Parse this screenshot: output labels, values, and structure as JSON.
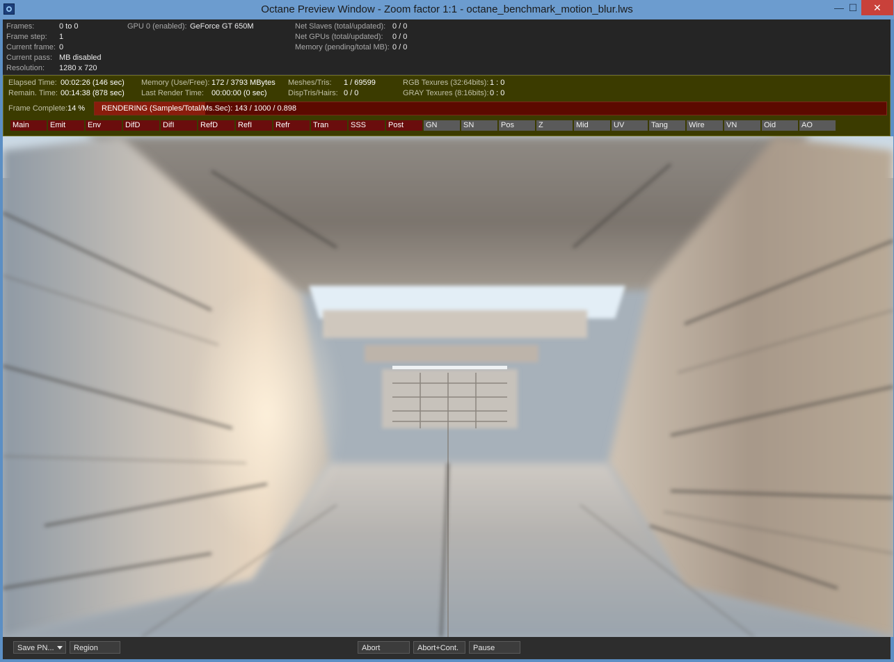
{
  "window": {
    "title": "Octane Preview Window - Zoom factor 1:1 - octane_benchmark_motion_blur.lws",
    "icons": [
      "app-icon",
      "minimize-icon",
      "maximize-icon",
      "close-icon"
    ],
    "minimize_glyph": "—",
    "maximize_glyph": "☐",
    "close_glyph": "✕"
  },
  "info": {
    "frames": {
      "label": "Frames:",
      "value": "0 to 0"
    },
    "frame_step": {
      "label": "Frame step:",
      "value": "1"
    },
    "current_frame": {
      "label": "Current frame:",
      "value": "0"
    },
    "current_pass": {
      "label": "Current pass:",
      "value": "MB disabled"
    },
    "resolution": {
      "label": "Resolution:",
      "value": "1280 x 720"
    },
    "gpu": {
      "label": "GPU  0 (enabled):",
      "value": "GeForce GT 650M"
    },
    "net_slaves": {
      "label": "Net Slaves (total/updated):",
      "value": "0 / 0"
    },
    "net_gpus": {
      "label": "Net GPUs (total/updated):",
      "value": "0 / 0"
    },
    "memory_pending": {
      "label": "Memory (pending/total MB):",
      "value": "0 / 0"
    }
  },
  "stats": {
    "elapsed": {
      "label": "Elapsed Time:",
      "value": "00:02:26 (146 sec)"
    },
    "remain": {
      "label": "Remain. Time:",
      "value": "00:14:38 (878 sec)"
    },
    "memory": {
      "label": "Memory (Use/Free):",
      "value": "172 / 3793 MBytes"
    },
    "last_render": {
      "label": "Last Render Time:",
      "value": "00:00:00 (0 sec)"
    },
    "meshes": {
      "label": "Meshes/Tris:",
      "value": "1 / 69599"
    },
    "disp": {
      "label": "DispTris/Hairs:",
      "value": "0 / 0"
    },
    "rgb_tex": {
      "label": "RGB Texures (32:64bits):",
      "value": "1 : 0"
    },
    "gray_tex": {
      "label": "GRAY Texures (8:16bits):",
      "value": "0 : 0"
    },
    "frame_complete": {
      "label": "Frame Complete:",
      "value": "14 %"
    },
    "progress_fraction": 0.14,
    "rendering_text": "RENDERING (Samples/Total/Ms.Sec): 143 / 1000 / 0.898"
  },
  "pass_tabs": [
    {
      "label": "Main",
      "active": true
    },
    {
      "label": "Emit",
      "active": true
    },
    {
      "label": "Env",
      "active": true
    },
    {
      "label": "DifD",
      "active": true
    },
    {
      "label": "DifI",
      "active": true
    },
    {
      "label": "RefD",
      "active": true
    },
    {
      "label": "RefI",
      "active": true
    },
    {
      "label": "Refr",
      "active": true
    },
    {
      "label": "Tran",
      "active": true
    },
    {
      "label": "SSS",
      "active": true
    },
    {
      "label": "Post",
      "active": true
    },
    {
      "label": "GN",
      "active": false
    },
    {
      "label": "SN",
      "active": false
    },
    {
      "label": "Pos",
      "active": false
    },
    {
      "label": "Z",
      "active": false
    },
    {
      "label": "Mid",
      "active": false
    },
    {
      "label": "UV",
      "active": false
    },
    {
      "label": "Tang",
      "active": false
    },
    {
      "label": "Wire",
      "active": false
    },
    {
      "label": "VN",
      "active": false
    },
    {
      "label": "Oid",
      "active": false
    },
    {
      "label": "AO",
      "active": false
    }
  ],
  "toolbar": {
    "save_label": "Save PN...",
    "region_label": "Region",
    "abort_label": "Abort",
    "abort_cont_label": "Abort+Cont.",
    "pause_label": "Pause"
  },
  "colors": {
    "titlebar": "#6c9ccf",
    "stats_panel": "#3b3b00",
    "progress_fill": "#8a1c0c",
    "active_tab": "#6a0d0d",
    "inactive_tab": "#5a5a5a"
  }
}
